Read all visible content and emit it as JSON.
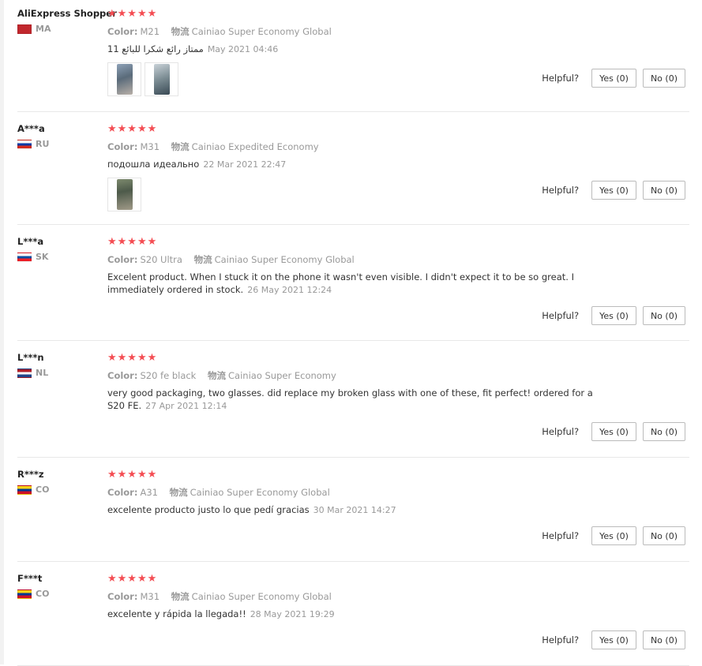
{
  "reviews": [
    {
      "user": "AliExpress Shopper",
      "country": "MA",
      "flag_colors": [
        "#c1272d",
        "#c1272d"
      ],
      "stars": "★★★★★",
      "attr1_key": "Color:",
      "attr1_val": "M21",
      "attr2_key": "物流",
      "attr2_val": "Cainiao Super Economy Global",
      "text": "11 ممتاز رائع شكرا للبائع",
      "time": "May 2021 04:46",
      "photos": 2,
      "helpful": "Helpful?",
      "yes": "Yes (0)",
      "no": "No (0)"
    },
    {
      "user": "A***a",
      "country": "RU",
      "flag_colors": [
        "#ffffff",
        "#0039a6",
        "#d52b1e"
      ],
      "stars": "★★★★★",
      "attr1_key": "Color:",
      "attr1_val": "M31",
      "attr2_key": "物流",
      "attr2_val": "Cainiao Expedited Economy",
      "text": "подошла идеально",
      "time": "22 Mar 2021 22:47",
      "photos": 1,
      "helpful": "Helpful?",
      "yes": "Yes (0)",
      "no": "No (0)"
    },
    {
      "user": "L***a",
      "country": "SK",
      "flag_colors": [
        "#ffffff",
        "#0b4ea2",
        "#ee1c25"
      ],
      "stars": "★★★★★",
      "attr1_key": "Color:",
      "attr1_val": "S20 Ultra",
      "attr2_key": "物流",
      "attr2_val": "Cainiao Super Economy Global",
      "text": "Excelent product. When I stuck it on the phone it wasn't even visible. I didn't expect it to be so great. I immediately ordered in stock.",
      "time": "26 May 2021 12:24",
      "photos": 0,
      "helpful": "Helpful?",
      "yes": "Yes (0)",
      "no": "No (0)"
    },
    {
      "user": "L***n",
      "country": "NL",
      "flag_colors": [
        "#ae1c28",
        "#ffffff",
        "#21468b"
      ],
      "stars": "★★★★★",
      "attr1_key": "Color:",
      "attr1_val": "S20 fe black",
      "attr2_key": "物流",
      "attr2_val": "Cainiao Super Economy",
      "text": "very good packaging, two glasses. did replace my broken glass with one of these, fit perfect! ordered for a S20 FE.",
      "time": "27 Apr 2021 12:14",
      "photos": 0,
      "helpful": "Helpful?",
      "yes": "Yes (0)",
      "no": "No (0)"
    },
    {
      "user": "R***z",
      "country": "CO",
      "flag_colors": [
        "#fcd116",
        "#003893",
        "#ce1126"
      ],
      "stars": "★★★★★",
      "attr1_key": "Color:",
      "attr1_val": "A31",
      "attr2_key": "物流",
      "attr2_val": "Cainiao Super Economy Global",
      "text": "excelente producto justo lo que pedí gracias",
      "time": "30 Mar 2021 14:27",
      "photos": 0,
      "helpful": "Helpful?",
      "yes": "Yes (0)",
      "no": "No (0)"
    },
    {
      "user": "F***t",
      "country": "CO",
      "flag_colors": [
        "#fcd116",
        "#003893",
        "#ce1126"
      ],
      "stars": "★★★★★",
      "attr1_key": "Color:",
      "attr1_val": "M31",
      "attr2_key": "物流",
      "attr2_val": "Cainiao Super Economy Global",
      "text": "excelente y rápida la llegada!!",
      "time": "28 May 2021 19:29",
      "photos": 0,
      "helpful": "Helpful?",
      "yes": "Yes (0)",
      "no": "No (0)"
    }
  ]
}
